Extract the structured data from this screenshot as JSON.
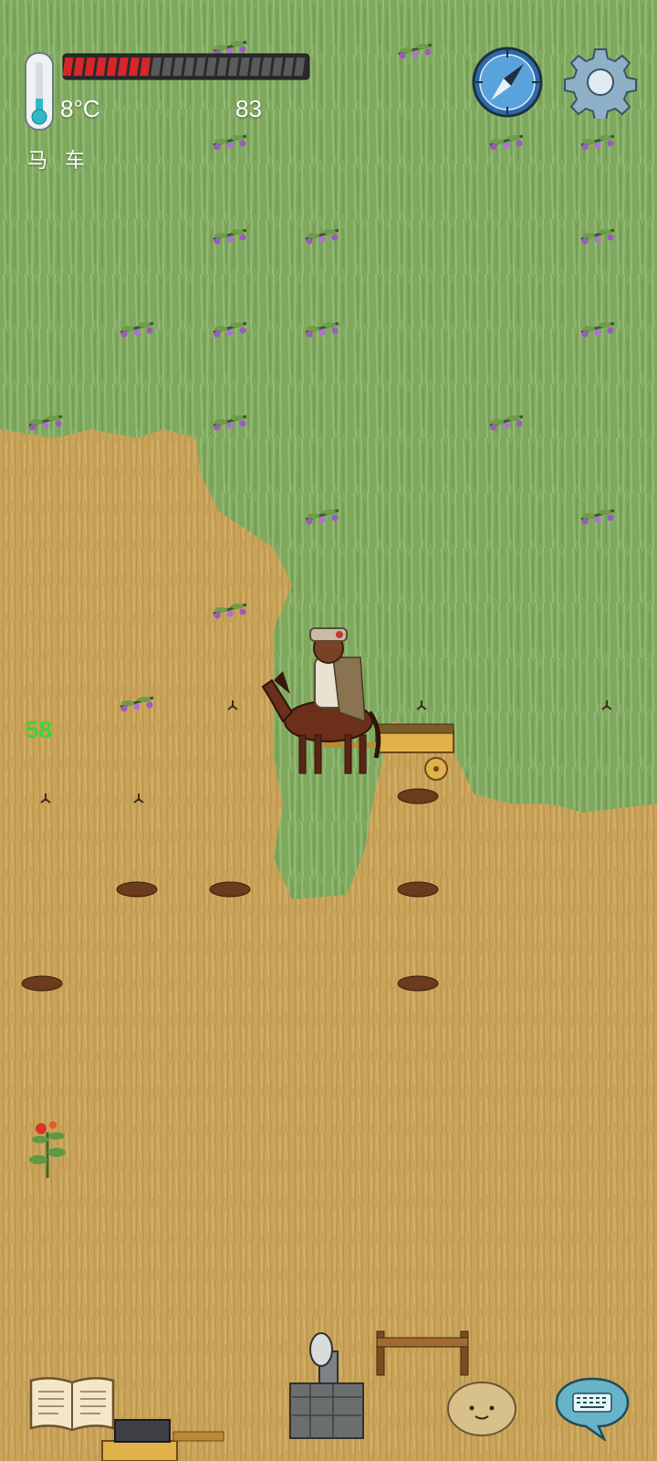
{
  "hud": {
    "temperature": "8°C",
    "food_value": "83",
    "food_pips_total": 22,
    "food_pips_filled": 8,
    "food_fill_color": "#d6262b",
    "food_empty_color": "#5a5a5a",
    "held_item_label": "马 车",
    "compass_icon": "compass-icon",
    "settings_icon": "gear-icon"
  },
  "world": {
    "floating_number": "58",
    "grass_color": "#7faa5e",
    "ground_color": "#c9a45a"
  },
  "bottom_bar": {
    "recipe_book_icon": "open-book-icon",
    "emote_icon": "smiling-potato-face-icon",
    "chat_icon": "keyboard-speech-bubble-icon"
  }
}
